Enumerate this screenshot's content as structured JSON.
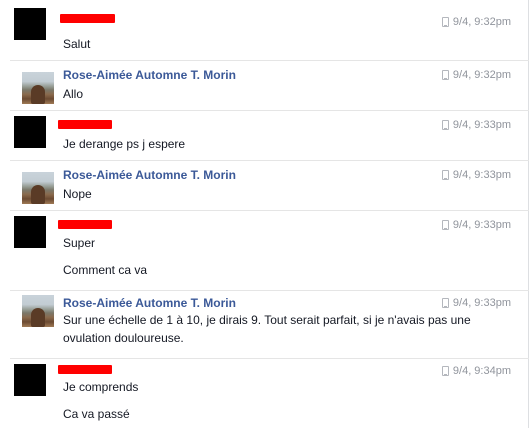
{
  "conversation": {
    "messages": [
      {
        "sender": "",
        "time": "9/4, 9:32pm",
        "lines": [
          "Salut"
        ]
      },
      {
        "sender": "Rose-Aimée Automne T. Morin",
        "time": "9/4, 9:32pm",
        "lines": [
          "Allo"
        ]
      },
      {
        "sender": "",
        "time": "9/4, 9:33pm",
        "lines": [
          "Je derange ps j espere"
        ]
      },
      {
        "sender": "Rose-Aimée Automne T. Morin",
        "time": "9/4, 9:33pm",
        "lines": [
          "Nope"
        ]
      },
      {
        "sender": "",
        "time": "9/4, 9:33pm",
        "lines": [
          "Super",
          "Comment ca va"
        ]
      },
      {
        "sender": "Rose-Aimée Automne T. Morin",
        "time": "9/4, 9:33pm",
        "lines": [
          "Sur une échelle de 1 à 10, je dirais 9. Tout serait parfait, si je n'avais pas une ovulation douloureuse."
        ]
      },
      {
        "sender": "",
        "time": "9/4, 9:34pm",
        "lines": [
          "Je comprends",
          "Ca va passé"
        ]
      }
    ]
  },
  "icons": {
    "device": "mobile-phone-icon",
    "redaction": "red-redaction-mark"
  },
  "colors": {
    "sender_name": "#3b5998",
    "timestamp": "#90949c",
    "redaction": "#ff0000",
    "avatar_redacted": "#000000"
  }
}
